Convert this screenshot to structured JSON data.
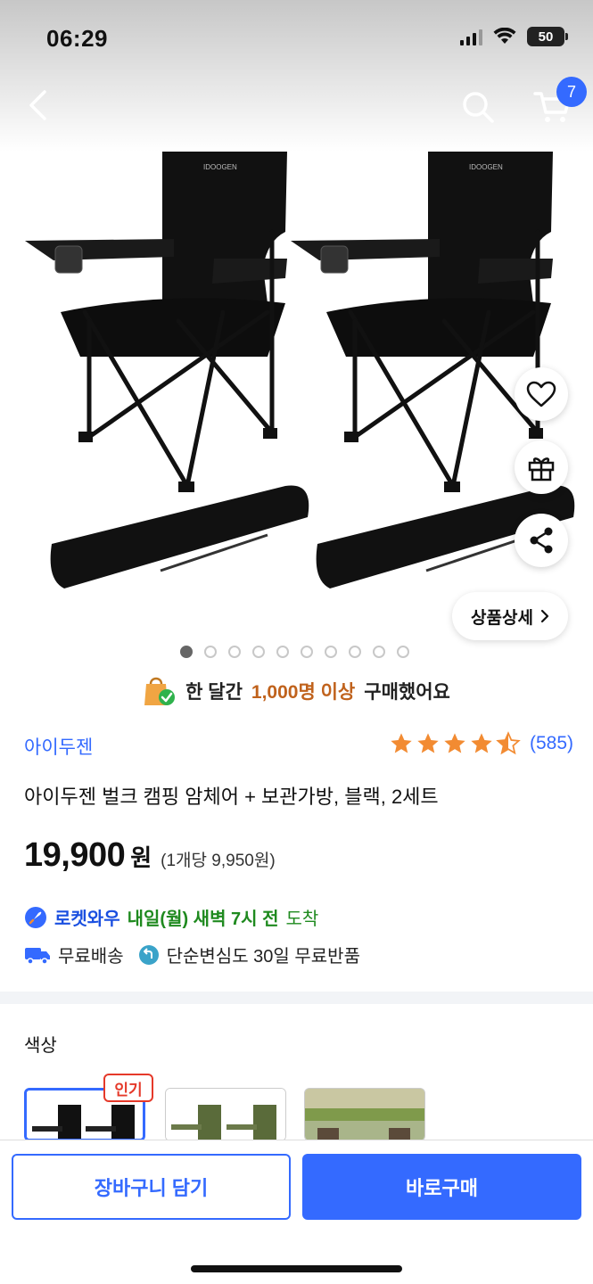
{
  "status": {
    "time": "06:29",
    "battery": "50"
  },
  "nav": {
    "cart_count": "7"
  },
  "gallery": {
    "detail_label": "상품상세",
    "page_count": 10,
    "active_page": 1
  },
  "purchase": {
    "prefix": "한 달간",
    "highlight": "1,000명 이상",
    "suffix": "구매했어요"
  },
  "product": {
    "brand": "아이두젠",
    "rating": 4.5,
    "review_count": "(585)",
    "title": "아이두젠 벌크 캠핑 암체어 + 보관가방, 블랙, 2세트",
    "price": "19,900",
    "currency": "원",
    "unit_price": "(1개당 9,950원)"
  },
  "delivery": {
    "brand": "로켓와우",
    "when": "내일(월) 새벽 7시 전",
    "arrive": "도착"
  },
  "perks": {
    "free_shipping": "무료배송",
    "returns": "단순변심도 30일 무료반품"
  },
  "options": {
    "label": "색상",
    "popular_badge": "인기"
  },
  "bottom": {
    "cart_label": "장바구니 담기",
    "buy_label": "바로구매"
  },
  "colors": {
    "accent": "#346aff",
    "rocket_green": "#1f8a1f",
    "badge_red": "#e5392a",
    "highlight_orange": "#c0621c"
  }
}
